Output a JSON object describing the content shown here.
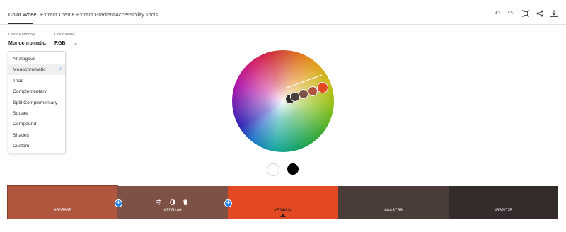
{
  "tabs": [
    "Color Wheel",
    "Extract Theme",
    "Extract Gradient",
    "Accessibility Tools"
  ],
  "toolbar": {
    "undo_icon": "undo-icon",
    "redo_icon": "redo-icon",
    "fullscreen_icon": "fullscreen-icon",
    "share_icon": "share-icon",
    "download_icon": "download-icon"
  },
  "harmony": {
    "label": "Color Harmony",
    "value": "Monochromatic",
    "options": [
      "Analogous",
      "Monochromatic",
      "Triad",
      "Complementary",
      "Split Complementary",
      "Square",
      "Compound",
      "Shades",
      "Custom"
    ]
  },
  "mode": {
    "label": "Color Mode",
    "value": "RGB"
  },
  "swatches": [
    {
      "hex": "#B0563F",
      "color": "#b0563f"
    },
    {
      "hex": "#7D5146",
      "color": "#7d5146"
    },
    {
      "hex": "#E34A24",
      "color": "#e34a24"
    },
    {
      "hex": "#4A3C38",
      "color": "#4a3c38"
    },
    {
      "hex": "#332C2B",
      "color": "#332c2b"
    }
  ],
  "base_swatches": {
    "white": "#ffffff",
    "black": "#000000"
  },
  "accent": "#2680eb"
}
